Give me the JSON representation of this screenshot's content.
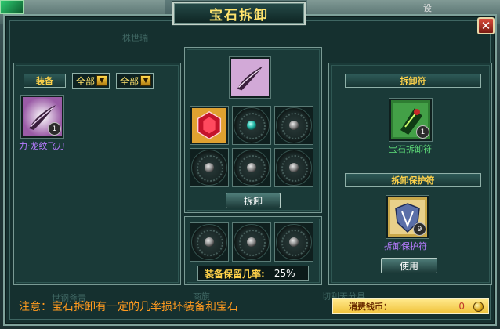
{
  "window": {
    "title": "宝石拆卸",
    "close_glyph": "✕"
  },
  "background_text": {
    "corner": "设",
    "faint_1": "株世瑞",
    "faint_2": "世钢斧青",
    "faint_3": "商旗",
    "faint_4": "切利天分县"
  },
  "left_panel": {
    "tab_label": "装备",
    "filter_1": "全部",
    "filter_2": "全部",
    "item": {
      "name": "力·龙纹飞刀",
      "count": "1"
    }
  },
  "center_panel": {
    "gem_slots": [
      {
        "kind": "ruby",
        "filled": true
      },
      {
        "kind": "teal-socket",
        "filled": false
      },
      {
        "kind": "socket",
        "filled": false
      },
      {
        "kind": "socket",
        "filled": false
      },
      {
        "kind": "socket",
        "filled": false
      },
      {
        "kind": "socket",
        "filled": false
      }
    ],
    "remove_button": "拆卸",
    "output_slots": 3,
    "retention_label": "装备保留几率:",
    "retention_value": "25%"
  },
  "right_panel": {
    "talisman_header": "拆卸符",
    "talisman": {
      "name": "宝石拆卸符",
      "count": "1"
    },
    "protect_header": "拆卸保护符",
    "protect": {
      "name": "拆卸保护符",
      "count": "9"
    },
    "use_button": "使用"
  },
  "footer": {
    "notice": "注意：宝石拆卸有一定的几率损坏装备和宝石",
    "cost_label": "消费钱币：",
    "cost_value": "0"
  },
  "colors": {
    "gold": "#ffe36d",
    "notice": "#ff9a1f",
    "purple_item": "#b77bff",
    "green_item": "#5fe07a"
  },
  "icons": [
    "close-icon",
    "dropdown-arrow-icon",
    "flying-knife-icon",
    "ruby-gem-icon",
    "gem-removal-talisman-icon",
    "protection-talisman-icon",
    "coin-icon"
  ]
}
